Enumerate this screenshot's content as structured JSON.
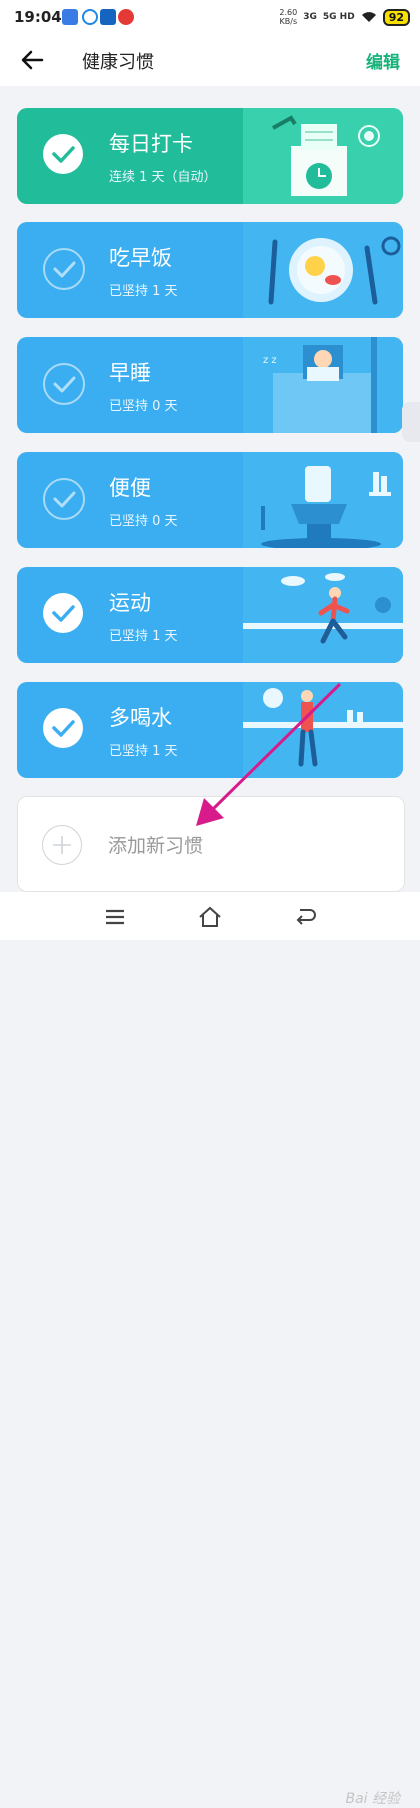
{
  "status_bar": {
    "time": "19:04",
    "net_speed_value": "2.60",
    "net_speed_unit": "KB/s",
    "signal_1": "3G",
    "signal_2": "5G HD",
    "battery": "92"
  },
  "header": {
    "title": "健康习惯",
    "edit_label": "编辑"
  },
  "habits": [
    {
      "name": "每日打卡",
      "subtitle": "连续 1 天（自动）",
      "checked": true,
      "color": "#21bd9b",
      "icon": "clock-box-illustration"
    },
    {
      "name": "吃早饭",
      "subtitle": "已坚持 1 天",
      "checked": false,
      "color": "#3aaef0",
      "icon": "breakfast-plate-illustration"
    },
    {
      "name": "早睡",
      "subtitle": "已坚持 0 天",
      "checked": false,
      "color": "#3aaef0",
      "icon": "sleeping-bed-illustration"
    },
    {
      "name": "便便",
      "subtitle": "已坚持 0 天",
      "checked": false,
      "color": "#3aaef0",
      "icon": "toilet-illustration"
    },
    {
      "name": "运动",
      "subtitle": "已坚持 1 天",
      "checked": true,
      "color": "#3aaef0",
      "icon": "runner-illustration"
    },
    {
      "name": "多喝水",
      "subtitle": "已坚持 1 天",
      "checked": true,
      "color": "#3aaef0",
      "icon": "drinking-water-illustration"
    }
  ],
  "add_habit": {
    "label": "添加新习惯"
  },
  "watermark": "Bai 经验",
  "colors": {
    "accent": "#17b27a",
    "annotation_arrow": "#d81b8a"
  }
}
